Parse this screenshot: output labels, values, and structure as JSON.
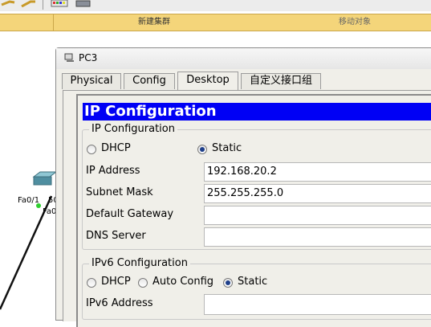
{
  "cluster_bar": {
    "new_cluster": "新建集群",
    "move_object": "移动对象"
  },
  "topology": {
    "port_label_1": "Fa0/1",
    "port_label_1_partial": "50",
    "port_label_2": "Fa0"
  },
  "window": {
    "title": "PC3",
    "tabs": [
      "Physical",
      "Config",
      "Desktop",
      "自定义接口组"
    ],
    "active_tab": "Desktop"
  },
  "ip_config": {
    "header": "IP Configuration",
    "group_title": "IP Configuration",
    "dhcp_label": "DHCP",
    "static_label": "Static",
    "mode": "Static",
    "ip_address_label": "IP Address",
    "ip_address": "192.168.20.2",
    "subnet_mask_label": "Subnet Mask",
    "subnet_mask": "255.255.255.0",
    "default_gateway_label": "Default Gateway",
    "default_gateway": "",
    "dns_server_label": "DNS Server",
    "dns_server": ""
  },
  "ipv6_config": {
    "group_title": "IPv6 Configuration",
    "dhcp_label": "DHCP",
    "auto_config_label": "Auto Config",
    "static_label": "Static",
    "mode": "Static",
    "ipv6_address_label": "IPv6 Address",
    "ipv6_address": ""
  }
}
